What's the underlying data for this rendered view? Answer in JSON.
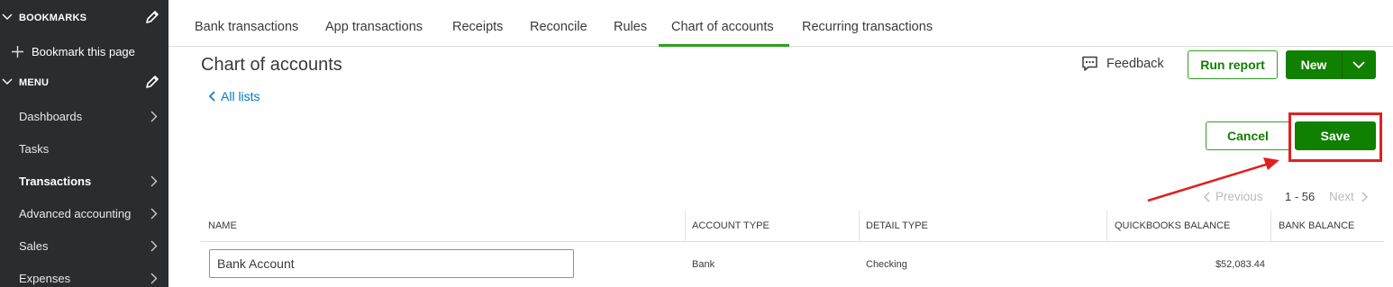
{
  "sidebar": {
    "bookmarks_label": "BOOKMARKS",
    "bookmark_this_page": "Bookmark this page",
    "menu_label": "MENU",
    "items": [
      {
        "label": "Dashboards"
      },
      {
        "label": "Tasks"
      },
      {
        "label": "Transactions"
      },
      {
        "label": "Advanced accounting"
      },
      {
        "label": "Sales"
      },
      {
        "label": "Expenses"
      }
    ]
  },
  "tabs": [
    {
      "label": "Bank transactions"
    },
    {
      "label": "App transactions"
    },
    {
      "label": "Receipts"
    },
    {
      "label": "Reconcile"
    },
    {
      "label": "Rules"
    },
    {
      "label": "Chart of accounts"
    },
    {
      "label": "Recurring transactions"
    }
  ],
  "header": {
    "title": "Chart of accounts",
    "all_lists": "All lists",
    "feedback": "Feedback",
    "run_report": "Run report",
    "new": "New"
  },
  "actions": {
    "cancel": "Cancel",
    "save": "Save"
  },
  "pagination": {
    "previous": "Previous",
    "range": "1 - 56",
    "next": "Next"
  },
  "table": {
    "columns": [
      "NAME",
      "ACCOUNT TYPE",
      "DETAIL TYPE",
      "QUICKBOOKS BALANCE",
      "BANK BALANCE"
    ],
    "rows": [
      {
        "name": "Bank Account",
        "account_type": "Bank",
        "detail_type": "Checking",
        "quickbooks_balance": "$52,083.44",
        "bank_balance": ""
      }
    ]
  },
  "colors": {
    "sidebar_bg": "#2b2c2f",
    "accent_green": "#108000",
    "active_tab_underline": "#2ca01c",
    "link_blue": "#0077c5",
    "annotation_red": "#e02020"
  }
}
